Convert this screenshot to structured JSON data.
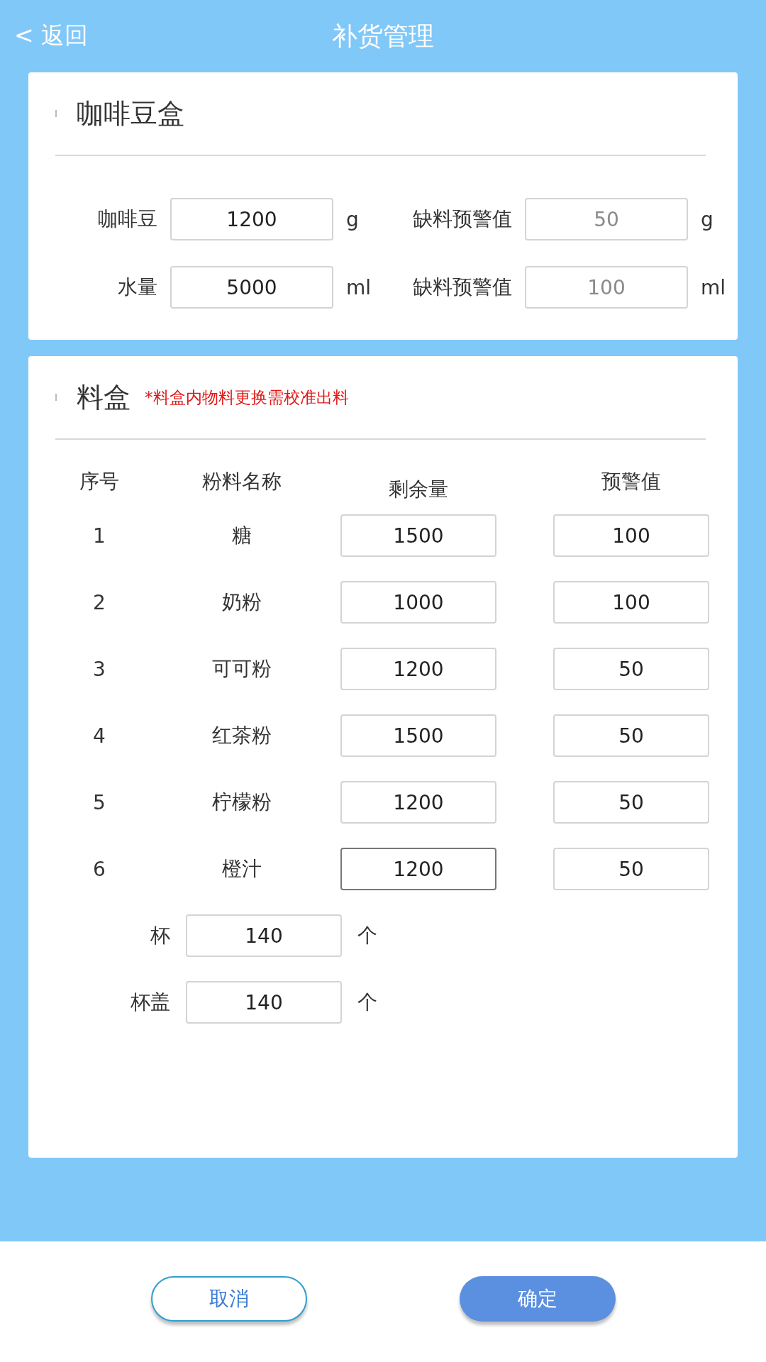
{
  "header": {
    "back": "< 返回",
    "title": "补货管理"
  },
  "bean_box": {
    "title": "咖啡豆盒",
    "rows": [
      {
        "label": "咖啡豆",
        "value": "1200",
        "unit": "g",
        "warn_label": "缺料预警值",
        "warn_value": "50",
        "warn_unit": "g",
        "warn_disabled": true
      },
      {
        "label": "水量",
        "value": "5000",
        "unit": "ml",
        "warn_label": "缺料预警值",
        "warn_value": "100",
        "warn_unit": "ml",
        "warn_disabled": true
      }
    ]
  },
  "material_box": {
    "title": "料盒",
    "note": "*料盒内物料更换需校准出料",
    "columns": [
      "序号",
      "粉料名称",
      "剩余量",
      "预警值"
    ],
    "rows": [
      {
        "index": "1",
        "name": "糖",
        "remaining": "1500",
        "warning": "100",
        "focused": false
      },
      {
        "index": "2",
        "name": "奶粉",
        "remaining": "1000",
        "warning": "100",
        "focused": false
      },
      {
        "index": "3",
        "name": "可可粉",
        "remaining": "1200",
        "warning": "50",
        "focused": false
      },
      {
        "index": "4",
        "name": "红茶粉",
        "remaining": "1500",
        "warning": "50",
        "focused": false
      },
      {
        "index": "5",
        "name": "柠檬粉",
        "remaining": "1200",
        "warning": "50",
        "focused": false
      },
      {
        "index": "6",
        "name": "橙汁",
        "remaining": "1200",
        "warning": "50",
        "focused": true
      }
    ],
    "cups": [
      {
        "label": "杯",
        "value": "140",
        "unit": "个"
      },
      {
        "label": "杯盖",
        "value": "140",
        "unit": "个"
      }
    ]
  },
  "buttons": [
    {
      "label": "取消",
      "kind": "secondary"
    },
    {
      "label": "确定",
      "kind": "primary"
    }
  ]
}
